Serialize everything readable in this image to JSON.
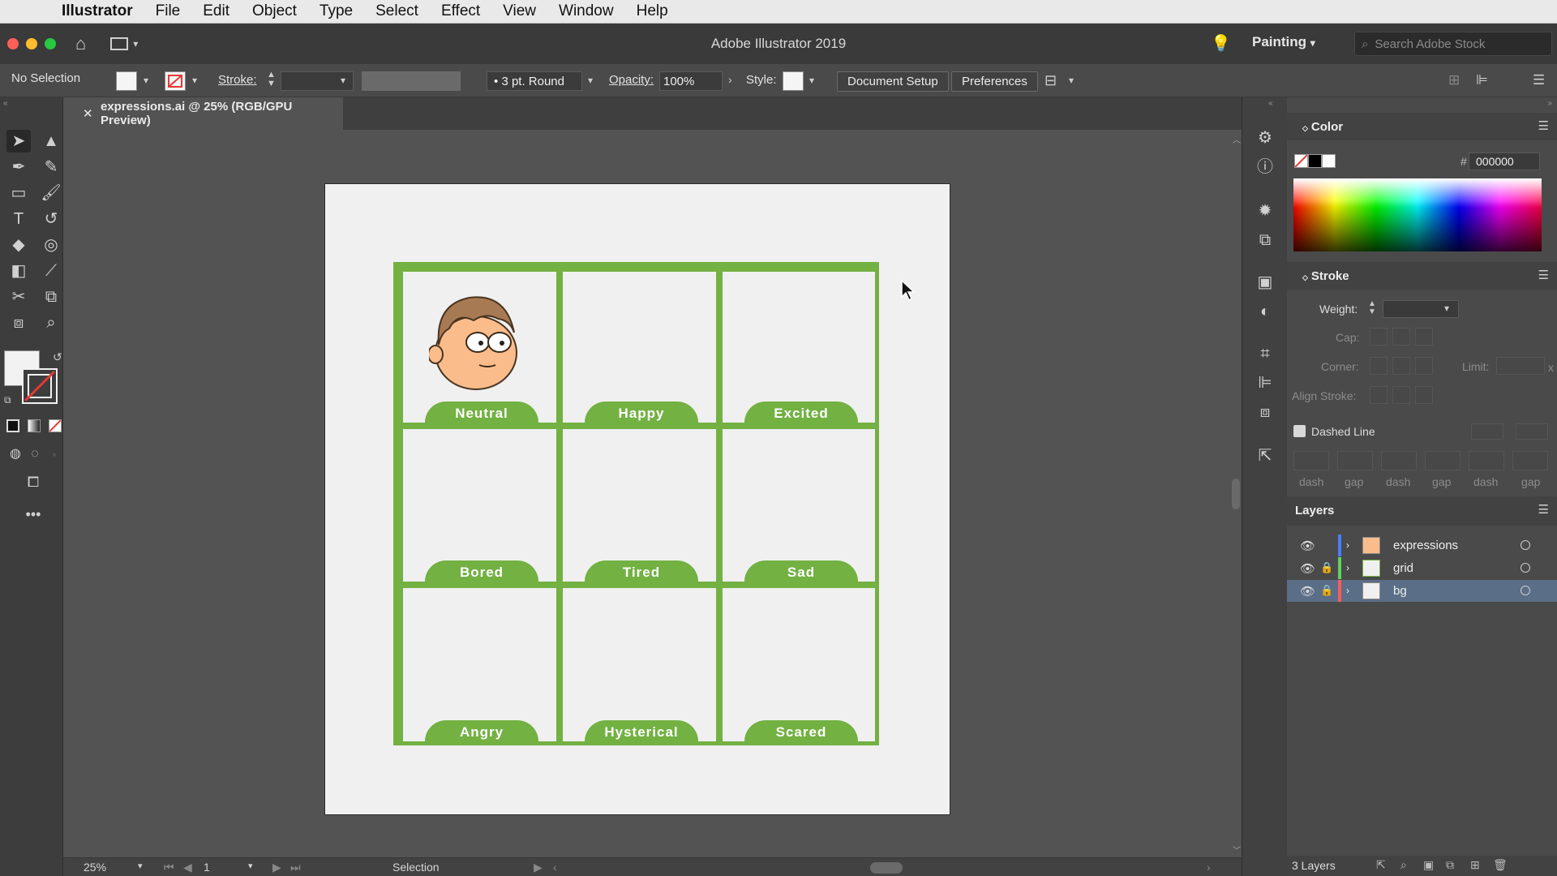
{
  "menubar": {
    "app_name": "Illustrator",
    "items": [
      "File",
      "Edit",
      "Object",
      "Type",
      "Select",
      "Effect",
      "View",
      "Window",
      "Help"
    ]
  },
  "titlebar": {
    "title": "Adobe Illustrator 2019",
    "workspace": "Painting",
    "search_placeholder": "Search Adobe Stock"
  },
  "controlbar": {
    "selection": "No Selection",
    "stroke_label": "Stroke:",
    "brush": "3 pt. Round",
    "opacity_label": "Opacity:",
    "opacity_value": "100%",
    "style_label": "Style:",
    "document_setup": "Document Setup",
    "preferences": "Preferences"
  },
  "document": {
    "tab_title": "expressions.ai @ 25% (RGB/GPU Preview)",
    "cells": [
      "Neutral",
      "Happy",
      "Excited",
      "Bored",
      "Tired",
      "Sad",
      "Angry",
      "Hysterical",
      "Scared"
    ],
    "grid_color": "#72b142"
  },
  "statusbar": {
    "zoom": "25%",
    "artboard_number": "1",
    "tool": "Selection"
  },
  "color_panel": {
    "title": "Color",
    "hex_symbol": "#",
    "hex_value": "000000"
  },
  "stroke_panel": {
    "title": "Stroke",
    "weight_label": "Weight:",
    "cap_label": "Cap:",
    "corner_label": "Corner:",
    "limit_label": "Limit:",
    "limit_x": "x",
    "align_label": "Align Stroke:",
    "dashed_label": "Dashed Line",
    "dash_gap_labels": [
      "dash",
      "gap",
      "dash",
      "gap",
      "dash",
      "gap"
    ]
  },
  "layers_panel": {
    "title": "Layers",
    "layers": [
      {
        "name": "expressions",
        "color": "#4a7dff",
        "locked": false
      },
      {
        "name": "grid",
        "color": "#5fd35f",
        "locked": true
      },
      {
        "name": "bg",
        "color": "#ff5a5a",
        "locked": true
      }
    ],
    "count": "3 Layers"
  }
}
